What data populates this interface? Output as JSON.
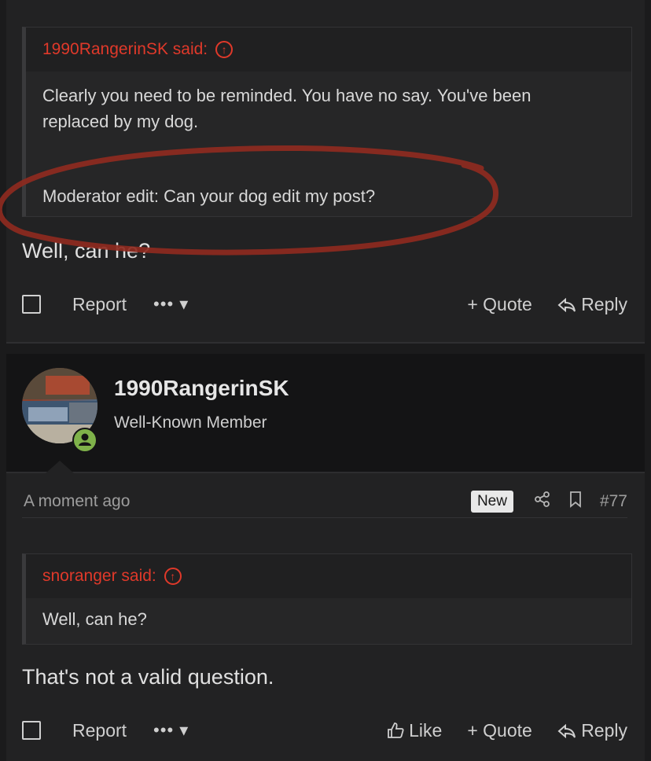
{
  "post1": {
    "quote": {
      "author": "1990RangerinSK said:",
      "lines": [
        "Clearly you need to be reminded. You have no say. You've been",
        "replaced by my dog."
      ],
      "moderator_edit": "Moderator edit: Can your dog edit my post?"
    },
    "text": "Well, can he?",
    "actions": {
      "report": "Report",
      "more": "•••",
      "quote": "+ Quote",
      "reply": "Reply"
    }
  },
  "post2": {
    "username": "1990RangerinSK",
    "user_title": "Well-Known Member",
    "time": "A moment ago",
    "badge": "New",
    "post_number": "#77",
    "quote": {
      "author": "snoranger said:",
      "text": "Well, can he?"
    },
    "text": "That's not a valid question.",
    "actions": {
      "report": "Report",
      "more": "•••",
      "like": "Like",
      "quote": "+ Quote",
      "reply": "Reply"
    }
  },
  "colors": {
    "accent_red": "#e0392a",
    "background": "#1b1b1c",
    "annotation": "#8e2a1f",
    "online": "#7fb24a"
  }
}
